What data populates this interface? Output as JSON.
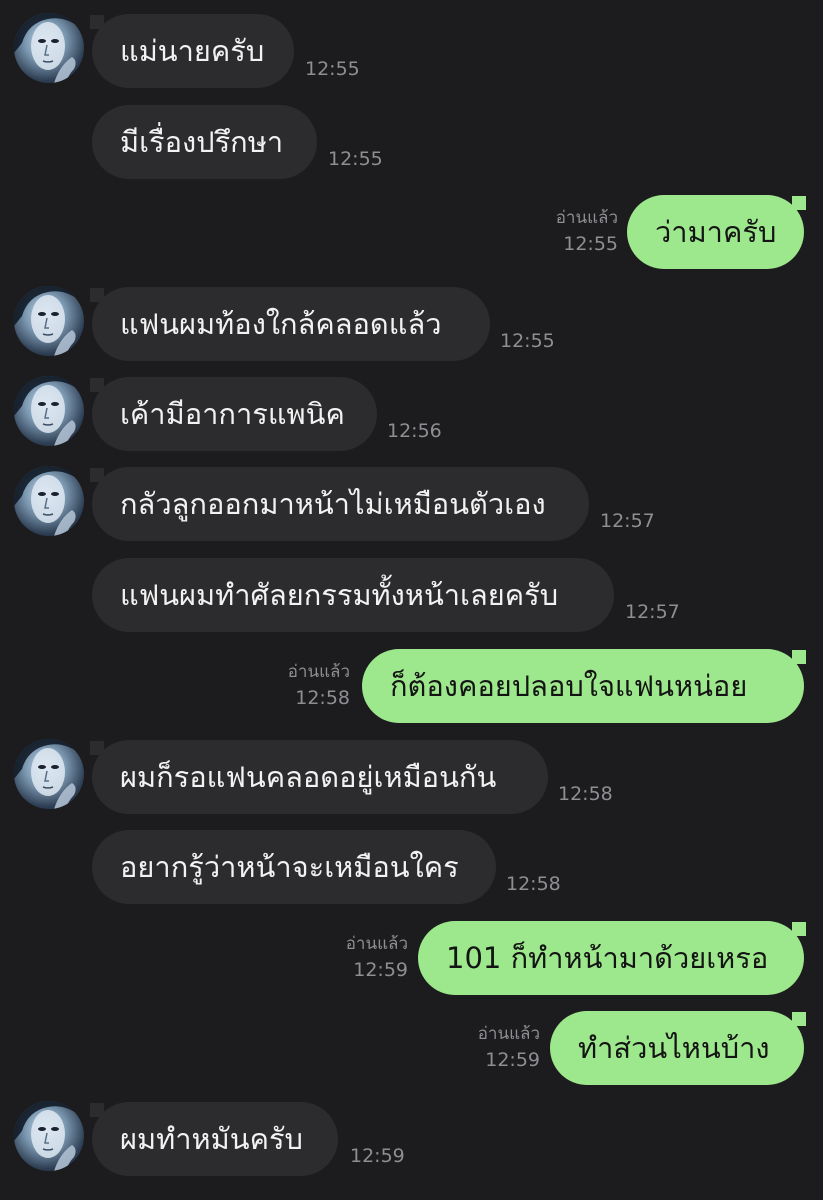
{
  "colors": {
    "background": "#1c1c1e",
    "incoming_bubble": "#2c2c2e",
    "outgoing_bubble": "#9de88c",
    "timestamp": "#8e8e93"
  },
  "messages": [
    {
      "direction": "in",
      "text": "แม่นายครับ",
      "time": "12:55",
      "avatar": true
    },
    {
      "direction": "in",
      "text": "มีเรื่องปรึกษา",
      "time": "12:55",
      "avatar": false
    },
    {
      "direction": "out",
      "text": "ว่ามาครับ",
      "time": "12:55",
      "read": "อ่านแล้ว"
    },
    {
      "direction": "in",
      "text": "แฟนผมท้องใกล้คลอดแล้ว",
      "time": "12:55",
      "avatar": true
    },
    {
      "direction": "in",
      "text": "เค้ามีอาการแพนิค",
      "time": "12:56",
      "avatar": true
    },
    {
      "direction": "in",
      "text": "กลัวลูกออกมาหน้าไม่เหมือนตัวเอง",
      "time": "12:57",
      "avatar": true
    },
    {
      "direction": "in",
      "text": "แฟนผมทำศัลยกรรมทั้งหน้าเลยครับ",
      "time": "12:57",
      "avatar": false
    },
    {
      "direction": "out",
      "text": "ก็ต้องคอยปลอบใจแฟนหน่อย",
      "time": "12:58",
      "read": "อ่านแล้ว"
    },
    {
      "direction": "in",
      "text": "ผมก็รอแฟนคลอดอยู่เหมือนกัน",
      "time": "12:58",
      "avatar": true
    },
    {
      "direction": "in",
      "text": "อยากรู้ว่าหน้าจะเหมือนใคร",
      "time": "12:58",
      "avatar": false
    },
    {
      "direction": "out",
      "text": "101 ก็ทำหน้ามาด้วยเหรอ",
      "time": "12:59",
      "read": "อ่านแล้ว"
    },
    {
      "direction": "out",
      "text": "ทำส่วนไหนบ้าง",
      "time": "12:59",
      "read": "อ่านแล้ว"
    },
    {
      "direction": "in",
      "text": "ผมทำหมันครับ",
      "time": "12:59",
      "avatar": true
    }
  ]
}
